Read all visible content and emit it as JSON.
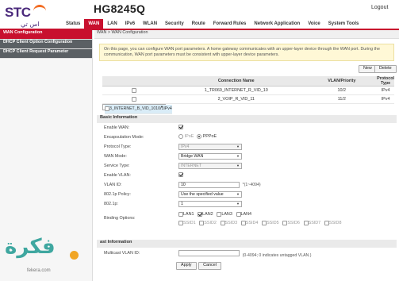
{
  "header": {
    "brand": "STC",
    "brand_sub": "اس تي سي",
    "model": "HG8245Q",
    "logout_label": "Logout",
    "nav": [
      "Status",
      "WAN",
      "LAN",
      "IPv6",
      "WLAN",
      "Security",
      "Route",
      "Forward Rules",
      "Network Application",
      "Voice",
      "System Tools"
    ],
    "active_nav": "WAN"
  },
  "sidebar": {
    "items": [
      {
        "label": "WAN Configuration",
        "state": "active"
      },
      {
        "label": "DHCP Client Option Configuration",
        "state": "gray"
      },
      {
        "label": "DHCP Client Request Parameter",
        "state": "gray"
      }
    ]
  },
  "breadcrumb": "WAN > WAN Configuration",
  "notice": "On this page, you can configure WAN port parameters. A home gateway communicates with an upper-layer device through the WAN port. During the communication, WAN port parameters must be consistent with upper-layer device parameters.",
  "toolbar": {
    "new_label": "New",
    "delete_label": "Delete"
  },
  "connections": {
    "headers": [
      "",
      "Connection Name",
      "VLAN/Priority",
      "Protocol Type"
    ],
    "rows": [
      {
        "name": "1_TR069_INTERNET_R_VID_10",
        "vlan": "10/2",
        "protocol": "IPv4",
        "selected": false
      },
      {
        "name": "2_VOIP_R_VID_11",
        "vlan": "11/2",
        "protocol": "IPv4",
        "selected": false
      },
      {
        "name": "3_INTERNET_B_VID_10",
        "vlan": "10/1",
        "protocol": "IPv4",
        "selected": true
      }
    ]
  },
  "basic": {
    "section_title": "Basic Information",
    "enable_wan_label": "Enable WAN:",
    "encap_label": "Encapsulation Mode:",
    "encap_options": [
      "IPoE",
      "PPPoE"
    ],
    "encap_selected": "PPPoE",
    "protocol_label": "Protocol Type:",
    "protocol_value": "IPv4",
    "wan_mode_label": "WAN Mode:",
    "wan_mode_value": "Bridge WAN",
    "service_type_label": "Service Type:",
    "service_type_value": "INTERNET",
    "enable_vlan_label": "Enable VLAN:",
    "vlan_id_label": "VLAN ID:",
    "vlan_id_value": "10",
    "vlan_id_hint": "*(1~4094)",
    "policy_label": "802.1p Policy:",
    "policy_value": "Use the specified value",
    "p8021_label": "802.1p:",
    "p8021_value": "1",
    "binding_label": "Binding Options:",
    "lan_ports": [
      {
        "label": "LAN1",
        "checked": false
      },
      {
        "label": "LAN2",
        "checked": true
      },
      {
        "label": "LAN3",
        "checked": false
      },
      {
        "label": "LAN4",
        "checked": false
      }
    ],
    "ssids": [
      "SSID1",
      "SSID2",
      "SSID3",
      "SSID4",
      "SSID5",
      "SSID6",
      "SSID7",
      "SSID8"
    ]
  },
  "mcast": {
    "section_title": "ast Information",
    "label": "Multicast VLAN ID:",
    "hint": "(0-4094; 0 indicates untagged VLAN.)"
  },
  "actions": {
    "apply_label": "Apply",
    "cancel_label": "Cancel"
  },
  "watermark": {
    "logo": "فكرة",
    "sub": "fekera.com"
  },
  "colors": {
    "accent": "#c8102e",
    "sidebar_gray": "#5b6064",
    "notice_bg": "#fff8d6",
    "selected_row": "#d9ecf7"
  }
}
